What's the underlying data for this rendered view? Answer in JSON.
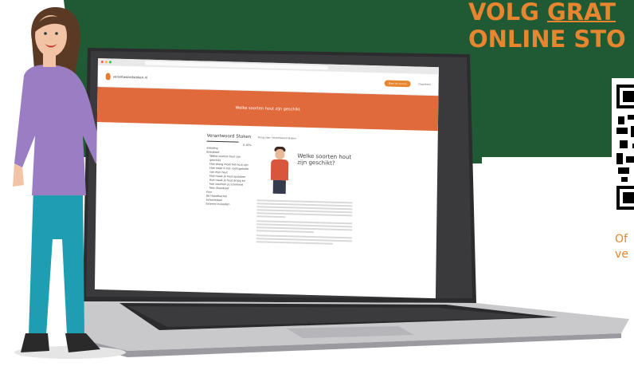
{
  "banner": {
    "headline_line1": "VOLG ",
    "headline_line1_underlined": "GRAT",
    "headline_line2": "ONLINE STO",
    "qr_caption_line1": "Of",
    "qr_caption_line2": "ve",
    "colors": {
      "dark_green": "#1f5a35",
      "orange": "#e8852f"
    }
  },
  "browser": {
    "site_logo": "verantwoordstoken.nl",
    "header_button": "Start de cursus",
    "header_link": "Doorlezen",
    "hero_title": "Welke soorten hout zijn geschikt",
    "back_link": "Terug naar: Verantwoord Stoken",
    "sidebar": {
      "title": "Verantwoord Stoken",
      "progress": "0.10%",
      "items": [
        "Inleiding",
        "Brandstof",
        "Welke soorten hout zijn geschikt",
        "Hoe droog moet het hout zijn",
        "Hoe meet ik het vochtgehalte van mijn hout",
        "Hoe maak je hout opstoken",
        "Hoe maak je hout droog en hoe voorkom je schimmel",
        "Test: Brandstof",
        "Vuur",
        "De Haardkachel",
        "Schoorsteen",
        "Externe invloeden"
      ]
    },
    "illustration_title": "Welke soorten hout zijn geschikt?"
  }
}
